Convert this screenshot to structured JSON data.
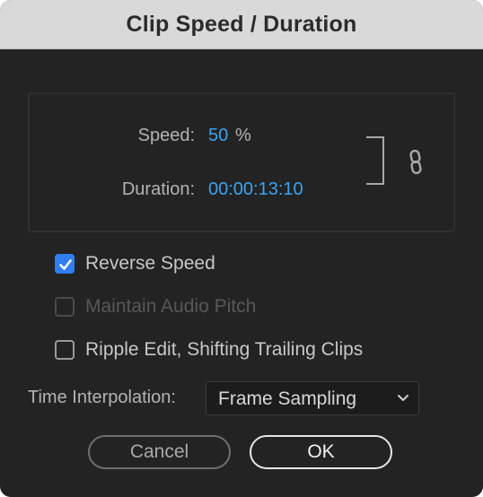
{
  "dialog": {
    "title": "Clip Speed / Duration"
  },
  "speed": {
    "label": "Speed:",
    "value": "50",
    "unit": "%"
  },
  "duration": {
    "label": "Duration:",
    "value": "00:00:13:10"
  },
  "link": {
    "icon": "link-icon",
    "linked": true
  },
  "options": {
    "reverse_speed": {
      "label": "Reverse Speed",
      "checked": true,
      "enabled": true
    },
    "maintain_audio_pitch": {
      "label": "Maintain Audio Pitch",
      "checked": false,
      "enabled": false
    },
    "ripple_edit": {
      "label": "Ripple Edit, Shifting Trailing Clips",
      "checked": false,
      "enabled": true
    }
  },
  "time_interpolation": {
    "label": "Time Interpolation:",
    "selected": "Frame Sampling"
  },
  "buttons": {
    "cancel": "Cancel",
    "ok": "OK"
  },
  "colors": {
    "accent_value": "#3aa3f0",
    "checkbox_checked": "#2f7ef2",
    "dialog_bg": "#232323",
    "titlebar_bg": "#d9d9d9"
  }
}
